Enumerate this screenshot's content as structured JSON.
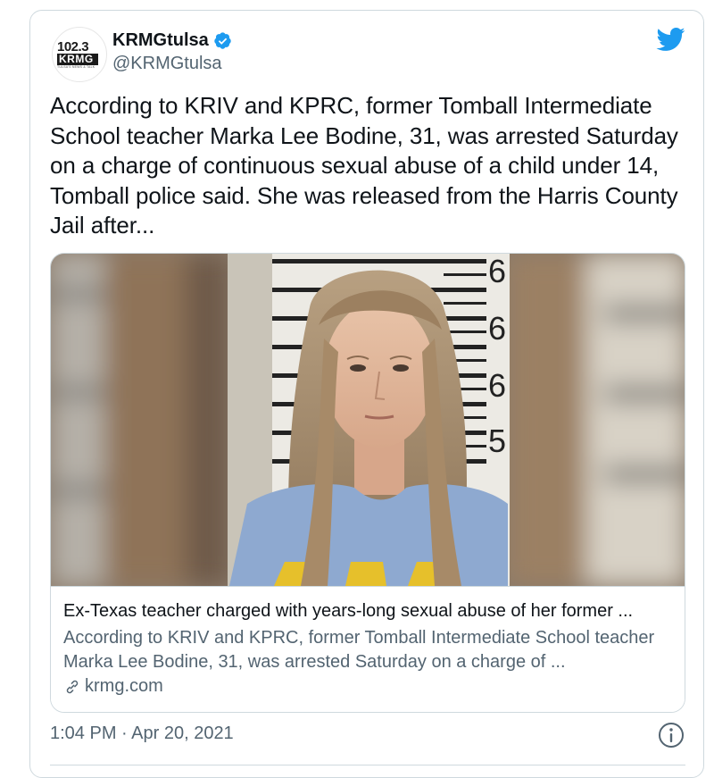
{
  "author": {
    "display_name": "KRMGtulsa",
    "handle": "@KRMGtulsa",
    "verified": true,
    "avatar_logo": {
      "number": "102.3",
      "callsign": "KRMG",
      "tagline": "TULSA'S NEWS & TALK"
    }
  },
  "tweet": {
    "text": "According to KRIV and KPRC, former Tomball Intermediate School teacher Marka Lee Bodine, 31, was arrested Saturday on a charge of continuous sexual abuse of a child under 14, Tomball police said. She was released from the Harris County Jail after...",
    "timestamp": "1:04 PM · Apr 20, 2021"
  },
  "link_card": {
    "title": "Ex-Texas teacher charged with years-long sexual abuse of her former ...",
    "description": "According to KRIV and KPRC, former Tomball Intermediate School teacher Marka Lee Bodine, 31, was arrested Saturday on a charge of ...",
    "domain": "krmg.com",
    "image_alt": "Booking photo with height chart background"
  },
  "icons": {
    "platform": "twitter-bird-icon",
    "verified": "verified-badge-icon",
    "link": "link-icon",
    "info": "info-icon"
  },
  "colors": {
    "brand_blue": "#1d9bf0",
    "text_primary": "#0f1419",
    "text_secondary": "#536471",
    "border": "#cfd9de"
  }
}
